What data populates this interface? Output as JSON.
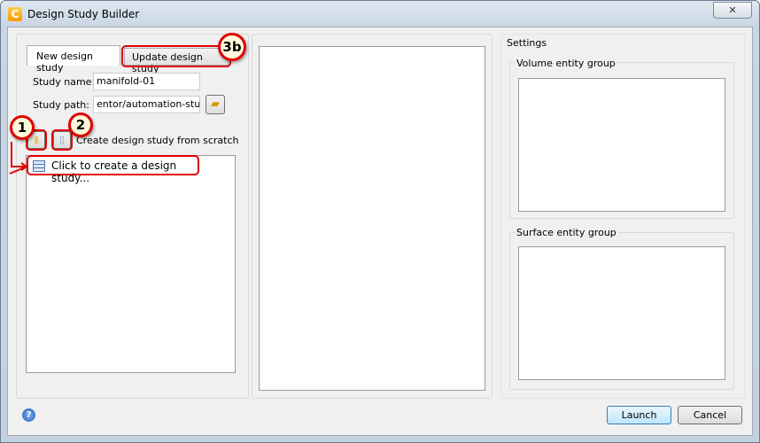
{
  "window": {
    "title": "Design Study Builder",
    "close_label": "✕"
  },
  "left": {
    "tabs": [
      {
        "label": "New design study"
      },
      {
        "label": "Update design study"
      }
    ],
    "study_name_label": "Study name:",
    "study_name_value": "manifold-01",
    "study_path_label": "Study path:",
    "study_path_value": "entor/automation-study",
    "create_from_scratch": "Create design study from scratch",
    "list_items": [
      {
        "label": "Click to create a design study..."
      }
    ]
  },
  "right": {
    "settings_label": "Settings",
    "volume_group": "Volume entity group",
    "surface_group": "Surface entity group"
  },
  "callouts": {
    "c1": "1",
    "c2": "2",
    "c3": "3b"
  },
  "footer": {
    "help": "?",
    "launch": "Launch",
    "cancel": "Cancel"
  }
}
